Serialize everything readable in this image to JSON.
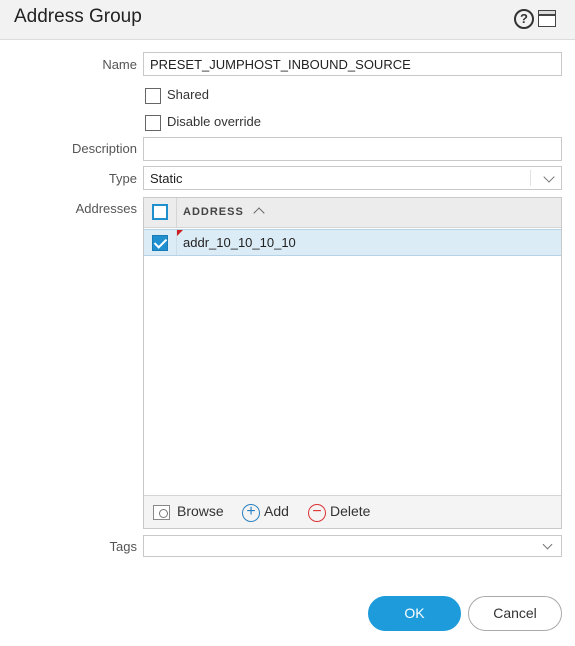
{
  "window": {
    "title": "Address Group",
    "help_icon": "?",
    "icons": [
      "help-icon",
      "window-icon"
    ]
  },
  "form": {
    "name_label": "Name",
    "name_value": "PRESET_JUMPHOST_INBOUND_SOURCE",
    "shared_label": "Shared",
    "shared_checked": false,
    "disable_override_label": "Disable override",
    "disable_override_checked": false,
    "description_label": "Description",
    "description_value": "",
    "type_label": "Type",
    "type_value": "Static",
    "addresses_label": "Addresses",
    "tags_label": "Tags",
    "tags_value": ""
  },
  "addresses_grid": {
    "column_header": "ADDRESS",
    "rows": [
      {
        "address": "addr_10_10_10_10",
        "checked": true
      }
    ],
    "toolbar": {
      "browse_label": "Browse",
      "add_label": "Add",
      "delete_label": "Delete"
    }
  },
  "buttons": {
    "ok_label": "OK",
    "cancel_label": "Cancel"
  },
  "colors": {
    "accent": "#1e9bdb",
    "selected_row": "#dcecf6",
    "delete": "#dd3333"
  }
}
